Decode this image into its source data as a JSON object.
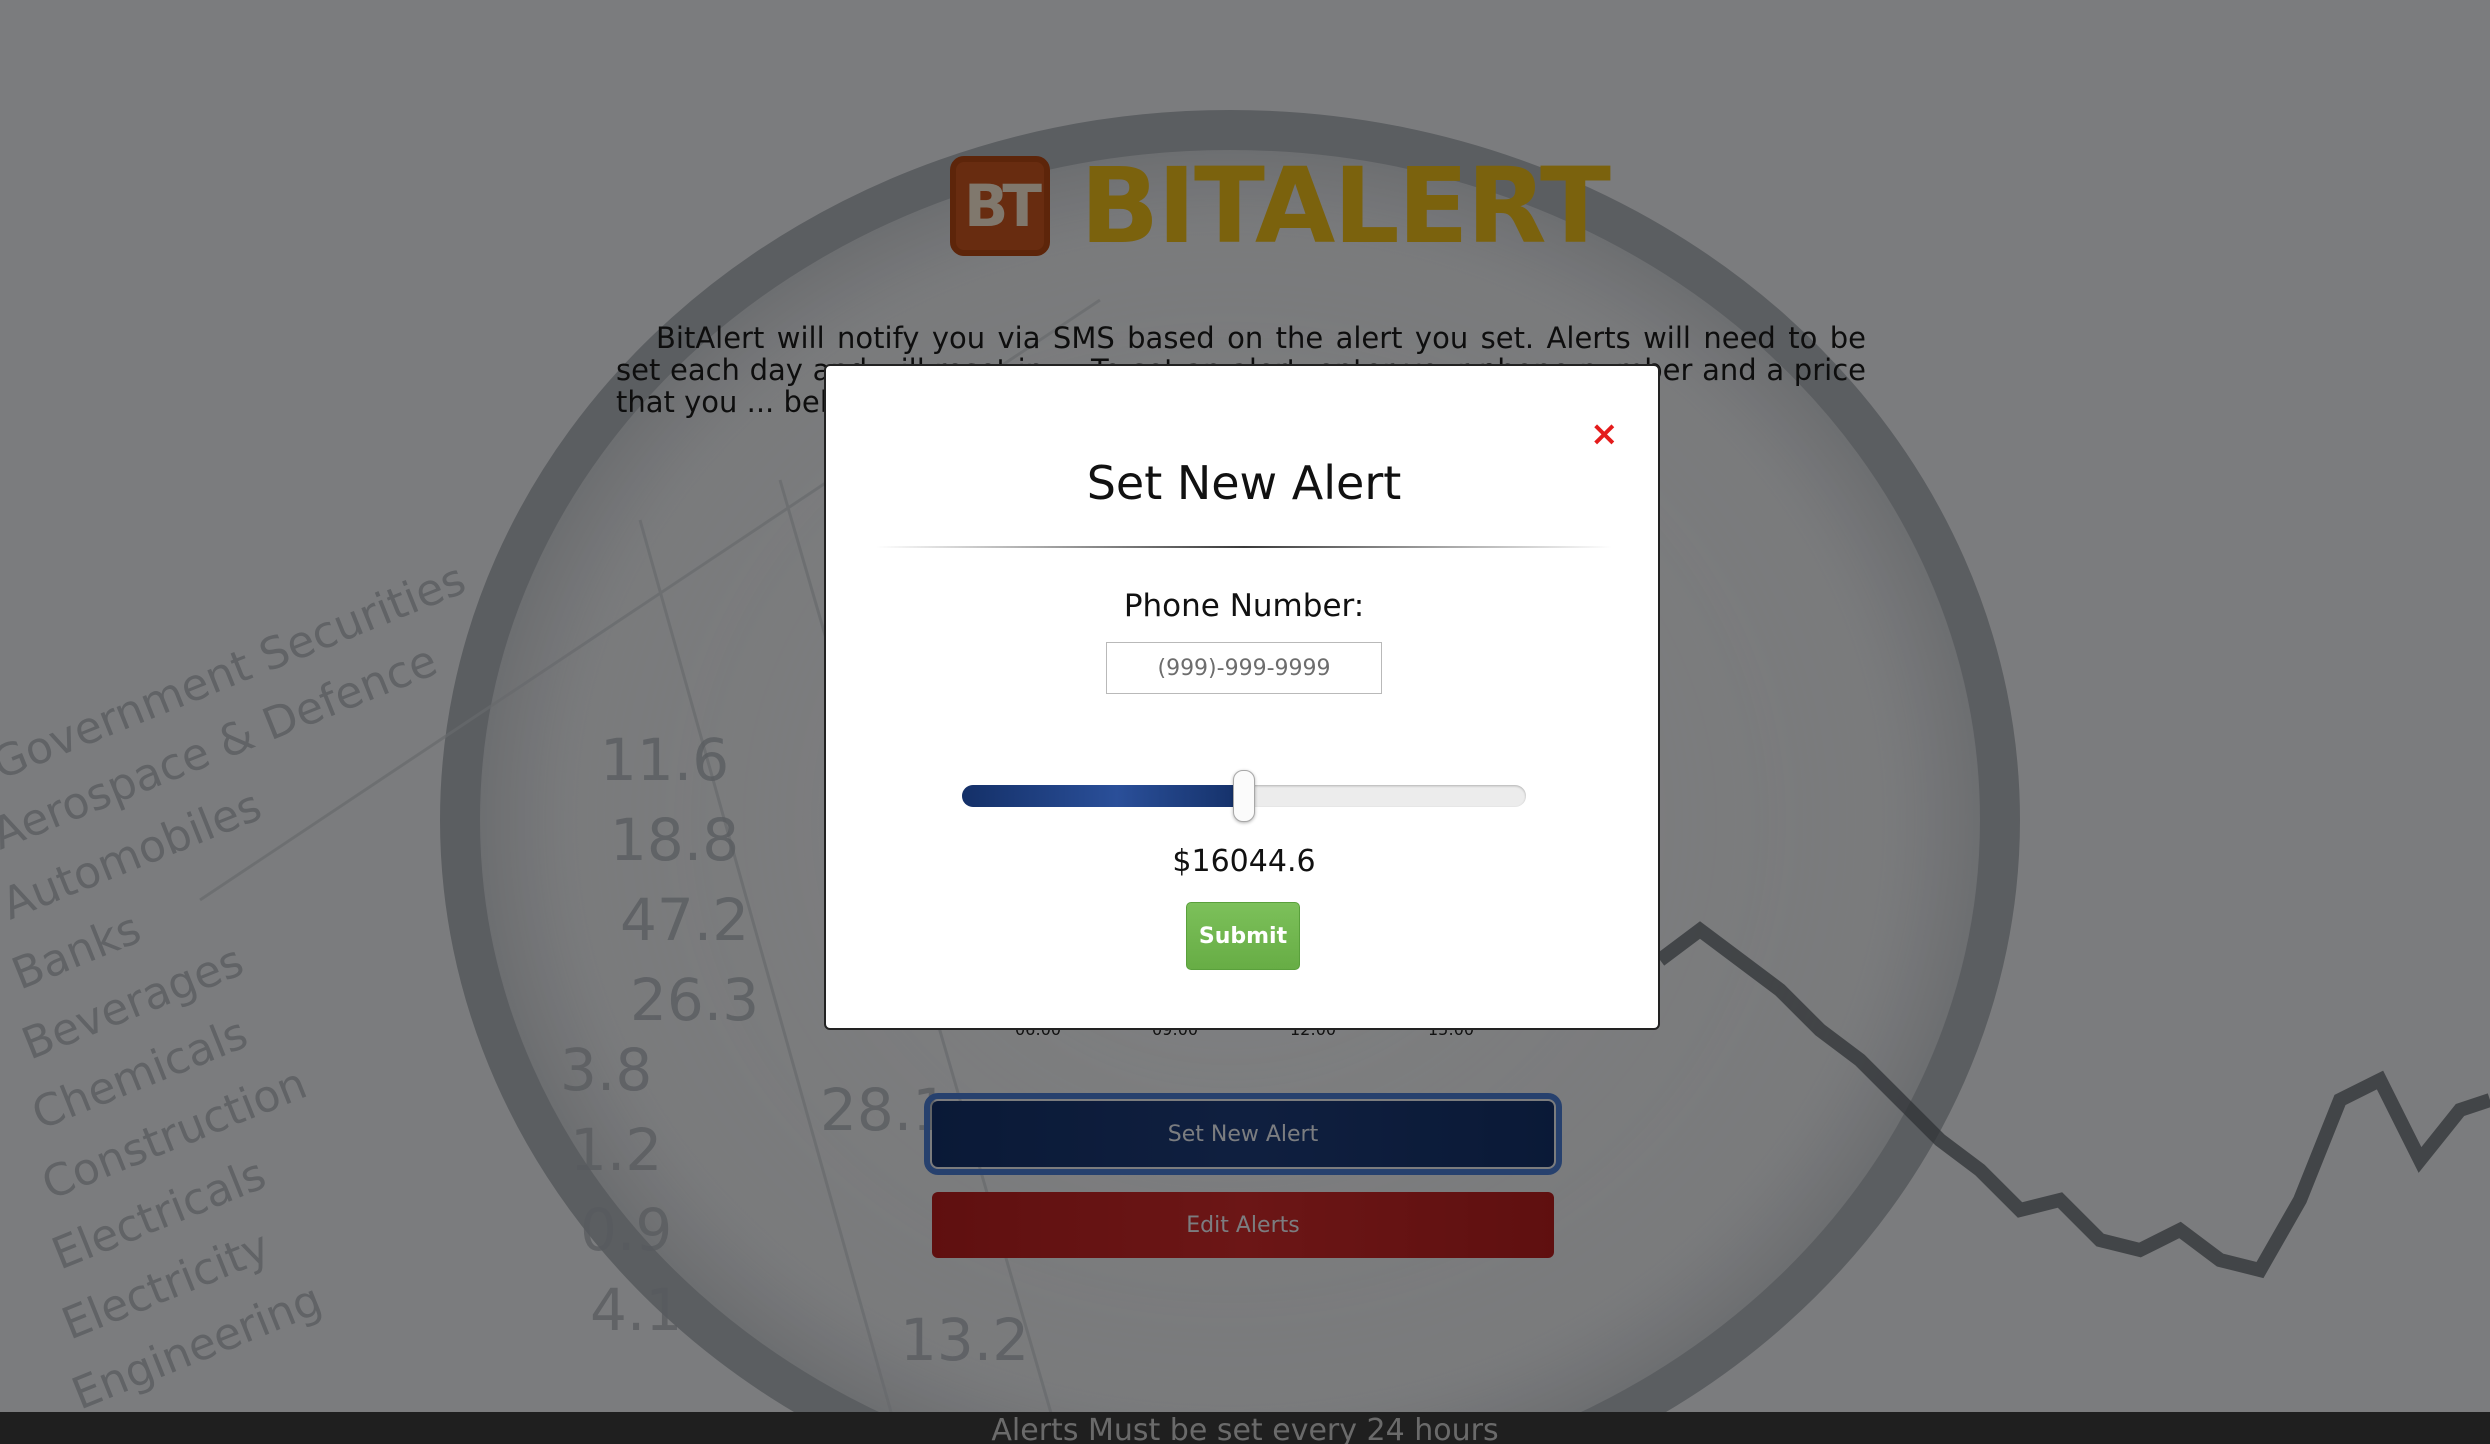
{
  "brand": {
    "logo_letters": "BT",
    "name": "BITALERT",
    "logo_color": "#c5541f",
    "name_color": "#e8b91a"
  },
  "intro": {
    "text": "BitAlert will notify you via SMS based on the alert you set. Alerts will need to be set each day and will reset in ... To set an alert, enter your phone number and a price that you ... below that you will recieve an ..."
  },
  "background_chart": {
    "time_ticks": [
      "06:00",
      "09:00",
      "12:00",
      "15:00"
    ]
  },
  "actions": {
    "set_new_alert_label": "Set New Alert",
    "edit_alerts_label": "Edit Alerts",
    "set_new_alert_color": "#143068",
    "edit_alerts_color": "#b41e1e"
  },
  "footer": {
    "text": "Alerts Must be set every 24 hours"
  },
  "modal": {
    "close_glyph": "×",
    "title": "Set New Alert",
    "phone_label": "Phone Number:",
    "phone_value": "",
    "phone_placeholder": "(999)-999-9999",
    "slider_fraction": 0.5,
    "price_display": "$16044.6",
    "submit_label": "Submit",
    "submit_color": "#6db54b",
    "close_color": "#e41b1b"
  }
}
